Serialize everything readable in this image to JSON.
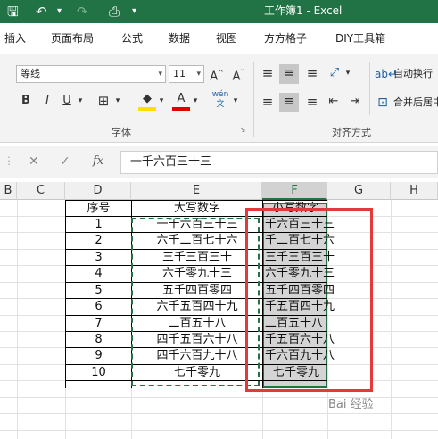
{
  "window": {
    "title": "工作簿1  -  Excel"
  },
  "menu_tabs": [
    "插入",
    "页面布局",
    "公式",
    "数据",
    "视图",
    "方方格子",
    "DIY工具箱"
  ],
  "ribbon": {
    "font_name": "等线",
    "font_size": "11",
    "font_group_label": "字体",
    "align_group_label": "对齐方式",
    "wrap_text_label": "自动换行",
    "merge_center_label": "合并后居中"
  },
  "formula_bar": {
    "value": "一千六百三十三"
  },
  "columns": [
    "B",
    "C",
    "D",
    "E",
    "F",
    "G",
    "H"
  ],
  "headers": {
    "seq": "序号",
    "upper": "大写数字",
    "lower": "小写数字"
  },
  "rows": [
    {
      "seq": "1",
      "upper": "一千六百三十三",
      "lower": "千六百三十三"
    },
    {
      "seq": "2",
      "upper": "六千二百七十六",
      "lower": "千二百七十六"
    },
    {
      "seq": "3",
      "upper": "三千三百三十",
      "lower": "三千三百三十"
    },
    {
      "seq": "4",
      "upper": "六千零九十三",
      "lower": "六千零九十三"
    },
    {
      "seq": "5",
      "upper": "五千四百零四",
      "lower": "五千四百零四"
    },
    {
      "seq": "6",
      "upper": "六千五百四十九",
      "lower": "千五百四十九"
    },
    {
      "seq": "7",
      "upper": "二百五十八",
      "lower": "二百五十八"
    },
    {
      "seq": "8",
      "upper": "四千五百六十八",
      "lower": "千五百六十八"
    },
    {
      "seq": "9",
      "upper": "四千六百九十八",
      "lower": "千六百九十八"
    },
    {
      "seq": "10",
      "upper": "七千零九",
      "lower": "七千零九"
    }
  ],
  "watermark": "Bai 经验",
  "colors": {
    "excel_green": "#217346",
    "highlight_red": "#e23a3a"
  }
}
